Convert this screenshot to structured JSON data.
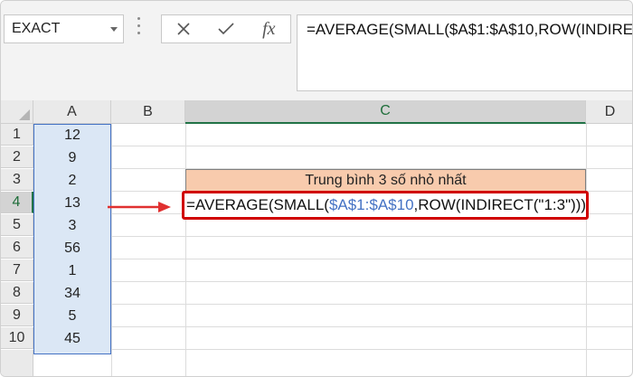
{
  "namebox": {
    "value": "EXACT"
  },
  "formula_bar": {
    "cancel_symbol": "✕",
    "enter_symbol": "✓",
    "fx_label": "fx",
    "formula": "=AVERAGE(SMALL($A$1:$A$10,ROW(INDIRECT("
  },
  "columns": [
    "A",
    "B",
    "C",
    "D"
  ],
  "rows": [
    "1",
    "2",
    "3",
    "4",
    "5",
    "6",
    "7",
    "8",
    "9",
    "10"
  ],
  "column_a": [
    "12",
    "9",
    "2",
    "13",
    "3",
    "56",
    "1",
    "34",
    "5",
    "45"
  ],
  "cell_c3": "Trung bình 3 số nhỏ nhất",
  "cell_c4": {
    "part1": "=AVERAGE(SMALL(",
    "range": "$A$1:$A$10",
    "part2": ",ROW(INDIRECT(",
    "literal": "\"1:3\"",
    "part3": "))))"
  },
  "colors": {
    "highlight_box": "#d00000",
    "title_fill": "#f8cbad",
    "range_fill": "#dbe7f5",
    "range_ref": "#4472c4"
  }
}
